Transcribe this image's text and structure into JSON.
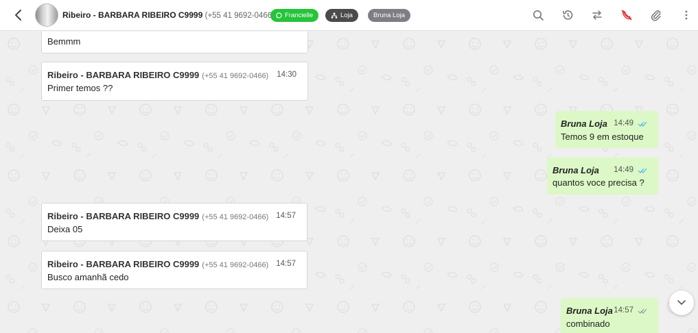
{
  "header": {
    "contact_name": "Ribeiro - BARBARA RIBEIRO C9999",
    "contact_phone": "(+55 41 9692-0466)",
    "badges": [
      {
        "label": "Francielle",
        "icon": "whatsapp-icon",
        "color": "#25c43b"
      },
      {
        "label": "Loja",
        "icon": "sitemap-icon",
        "color": "#4b4b4b"
      },
      {
        "label": "Bruna Loja",
        "color": "#7d7f84"
      }
    ],
    "icons": [
      "search-icon",
      "history-icon",
      "transfer-icon",
      "phone-off-icon",
      "attachment-icon",
      "more-icon"
    ]
  },
  "messages": [
    {
      "direction": "in",
      "sender": "",
      "phone": "",
      "time": "",
      "text": "Bemmm"
    },
    {
      "direction": "in",
      "sender": "Ribeiro - BARBARA RIBEIRO C9999",
      "phone": "(+55 41 9692-0466)",
      "time": "14:30",
      "text": "Primer temos ??"
    },
    {
      "direction": "out",
      "sender": "Bruna Loja",
      "time": "14:49",
      "text": "Temos 9 em estoque",
      "status": "read"
    },
    {
      "direction": "out",
      "sender": "Bruna Loja",
      "time": "14:49",
      "text": "quantos voce precisa ?",
      "status": "read"
    },
    {
      "direction": "in",
      "sender": "Ribeiro - BARBARA RIBEIRO C9999",
      "phone": "(+55 41 9692-0466)",
      "time": "14:57",
      "text": "Deixa 05"
    },
    {
      "direction": "in",
      "sender": "Ribeiro - BARBARA RIBEIRO C9999",
      "phone": "(+55 41 9692-0466)",
      "time": "14:57",
      "text": "Busco amanhã cedo"
    },
    {
      "direction": "out",
      "sender": "Bruna Loja",
      "time": "14:57",
      "text": "combinado",
      "status": "delivered"
    }
  ],
  "colors": {
    "outgoing_bubble": "#dcf8c6",
    "read_ticks": "#4fb6ec",
    "delivered_ticks": "#999999"
  }
}
